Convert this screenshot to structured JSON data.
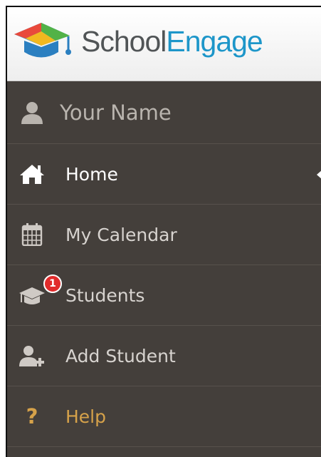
{
  "brand": {
    "name_part1": "School",
    "name_part2": "Engage",
    "logo_icon": "graduation-cap-logo",
    "colors": {
      "dark": "#505456",
      "accent": "#1d96c9"
    }
  },
  "sidebar": {
    "background": "#443f3b",
    "user": {
      "label": "Your Name",
      "icon": "user-icon"
    },
    "items": [
      {
        "label": "Home",
        "icon": "home-icon",
        "active": true
      },
      {
        "label": "My Calendar",
        "icon": "calendar-icon"
      },
      {
        "label": "Students",
        "icon": "graduation-cap-icon",
        "badge": "1"
      },
      {
        "label": "Add Student",
        "icon": "add-user-icon"
      },
      {
        "label": "Help",
        "icon": "question-icon",
        "color": "#d6a24a"
      }
    ]
  }
}
